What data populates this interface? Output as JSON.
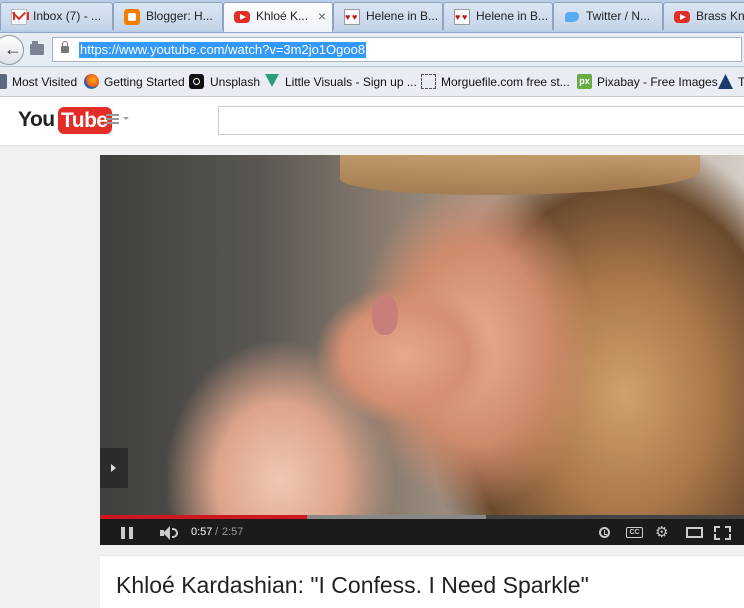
{
  "browser": {
    "tabs": [
      {
        "title": "Inbox (7) - ...",
        "icon": "gmail-icon",
        "active": false
      },
      {
        "title": "Blogger: H...",
        "icon": "blogger-icon",
        "active": false
      },
      {
        "title": "Khloé K...",
        "icon": "youtube-icon",
        "active": true
      },
      {
        "title": "Helene in B...",
        "icon": "heart-icon",
        "active": false
      },
      {
        "title": "Helene in B...",
        "icon": "heart-icon",
        "active": false
      },
      {
        "title": "Twitter / N...",
        "icon": "twitter-icon",
        "active": false
      },
      {
        "title": "Brass Knu...",
        "icon": "youtube-icon",
        "active": false
      }
    ],
    "tab_close_glyph": "×",
    "url": "https://www.youtube.com/watch?v=3m2jo1Ogoo8",
    "bookmarks": [
      {
        "label": "Most Visited",
        "icon": "most-visited-icon"
      },
      {
        "label": "Getting Started",
        "icon": "firefox-icon"
      },
      {
        "label": "Unsplash",
        "icon": "camera-icon"
      },
      {
        "label": "Little Visuals - Sign up ...",
        "icon": "little-visuals-icon"
      },
      {
        "label": "Morguefile.com free st...",
        "icon": "morguefile-icon"
      },
      {
        "label": "Pixabay - Free Images",
        "icon": "pixabay-icon"
      },
      {
        "label": "T",
        "icon": "sailboat-icon"
      }
    ]
  },
  "youtube": {
    "logo_you": "You",
    "logo_tube": "Tube",
    "search_placeholder": "",
    "player": {
      "time_current": "0:57",
      "time_separator": "/",
      "time_duration": "2:57",
      "progress_fraction": 0.322,
      "buffered_fraction": 0.6,
      "cc_label": "CC",
      "settings_glyph": "⚙"
    },
    "video_title": "Khloé Kardashian: \"I Confess. I Need Sparkle\"",
    "colors": {
      "brand_red": "#e52d27",
      "progress_red": "#cc181e"
    }
  }
}
